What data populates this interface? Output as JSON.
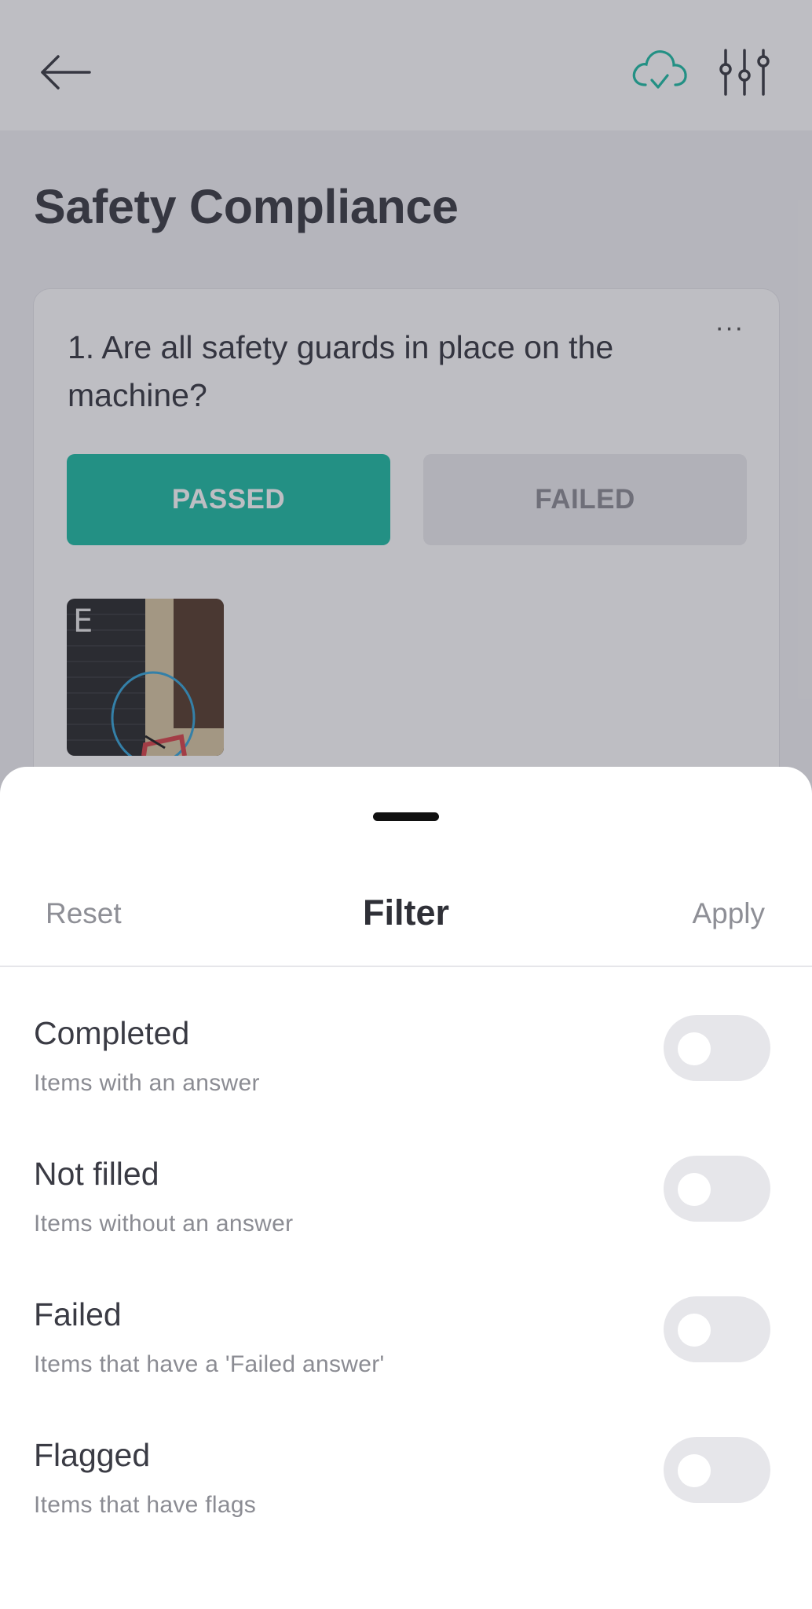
{
  "header": {
    "back_icon": "arrow-left-icon",
    "sync_icon": "cloud-check-icon",
    "settings_icon": "sliders-icon",
    "accent_color": "#22bda5"
  },
  "page": {
    "title": "Safety Compliance"
  },
  "question_card": {
    "question": "1. Are all safety guards in place on the machine?",
    "more_label": "···",
    "passed_label": "PASSED",
    "failed_label": "FAILED",
    "selected_answer": "PASSED",
    "passed_color": "#22bda5",
    "photo_marker": "E"
  },
  "filter_sheet": {
    "reset_label": "Reset",
    "title": "Filter",
    "apply_label": "Apply",
    "options": [
      {
        "title": "Completed",
        "description": "Items with an answer",
        "enabled": false
      },
      {
        "title": "Not filled",
        "description": "Items without an answer",
        "enabled": false
      },
      {
        "title": "Failed",
        "description": "Items that have a 'Failed answer'",
        "enabled": false
      },
      {
        "title": "Flagged",
        "description": "Items that have flags",
        "enabled": false
      }
    ]
  }
}
